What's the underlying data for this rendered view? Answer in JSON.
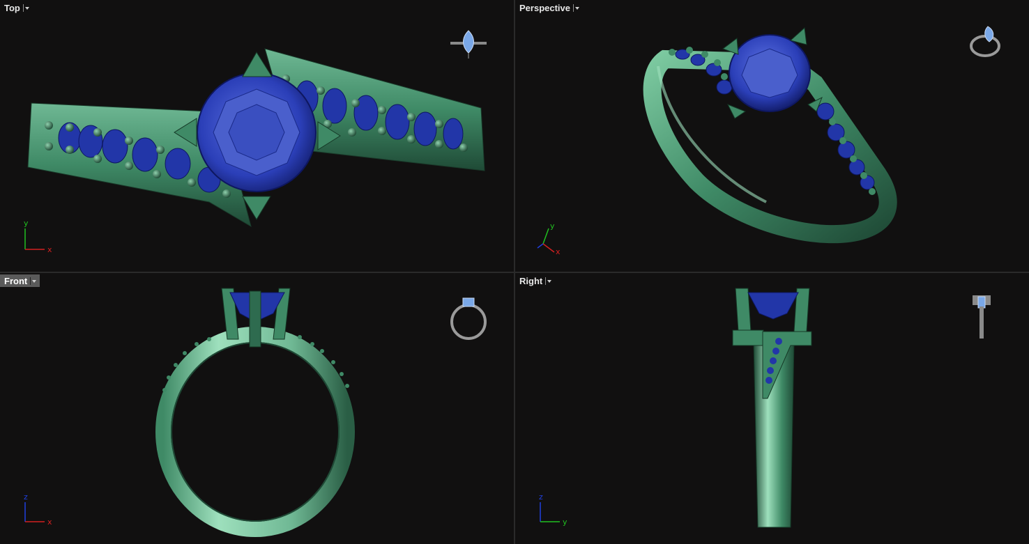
{
  "viewports": {
    "top": {
      "label": "Top",
      "axes": {
        "horizontal": "x",
        "vertical": "y"
      }
    },
    "perspective": {
      "label": "Perspective",
      "axes": {
        "horizontal": "x",
        "vertical": "y"
      }
    },
    "front": {
      "label": "Front",
      "active": true,
      "axes": {
        "horizontal": "x",
        "vertical": "z"
      }
    },
    "right": {
      "label": "Right",
      "axes": {
        "horizontal": "y",
        "vertical": "z"
      }
    }
  },
  "colors": {
    "background": "#111010",
    "metal": "#3f8a66",
    "metal_highlight": "#9ee0bd",
    "gem": "#2b3fb8",
    "gem_highlight": "#5a6fe0",
    "axis_x": "#d42020",
    "axis_y": "#20c020",
    "axis_z": "#2040e0"
  },
  "icons": [
    "view-cube-ring-thumbnail-icon",
    "dropdown-caret-icon",
    "axis-triad-icon"
  ]
}
